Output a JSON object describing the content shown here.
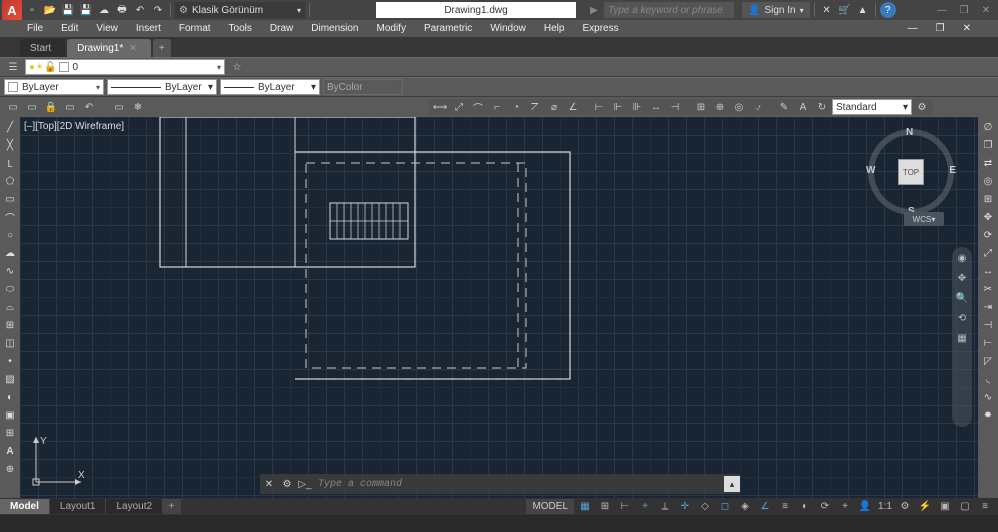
{
  "workspace_label": "Klasik Görünüm",
  "doc_title": "Drawing1.dwg",
  "search_placeholder": "Type a keyword or phrase",
  "sign_in": "Sign In",
  "menu": [
    "File",
    "Edit",
    "View",
    "Insert",
    "Format",
    "Tools",
    "Draw",
    "Dimension",
    "Modify",
    "Parametric",
    "Window",
    "Help",
    "Express"
  ],
  "doc_tabs": {
    "start": "Start",
    "active": "Drawing1*"
  },
  "layer": {
    "current": "0"
  },
  "props": {
    "color_label": "ByLayer",
    "ltype_label": "ByLayer",
    "lweight_label": "ByLayer",
    "bycolor": "ByColor",
    "dim_style": "Standard"
  },
  "viewport_label": "[–][Top][2D Wireframe]",
  "viewcube": {
    "top": "TOP",
    "n": "N",
    "s": "S",
    "e": "E",
    "w": "W",
    "wcs": "WCS"
  },
  "ucs": {
    "x": "X",
    "y": "Y"
  },
  "cmd_placeholder": "Type a command",
  "layout_tabs": {
    "model": "Model",
    "l1": "Layout1",
    "l2": "Layout2"
  },
  "status_model": "MODEL"
}
